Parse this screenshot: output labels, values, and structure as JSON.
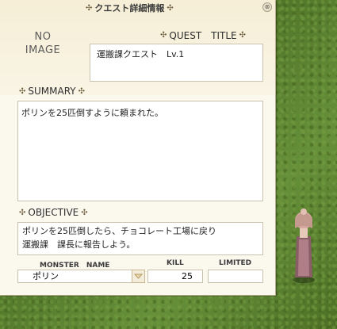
{
  "window": {
    "title": "クエスト詳細情報",
    "close_label": "⊗"
  },
  "image_placeholder": {
    "line1": "NO",
    "line2": "IMAGE"
  },
  "quest_title": {
    "label": "QUEST　TITLE",
    "value": "運搬課クエスト　Lv.1"
  },
  "summary": {
    "label": "SUMMARY",
    "text": "ポリンを25匹倒すように頼まれた。"
  },
  "objective": {
    "label": "OBJECTIVE",
    "lines": [
      "ポリンを25匹倒したら、チョコレート工場に戻り",
      "運搬課　課長に報告しよう。"
    ]
  },
  "table": {
    "headers": {
      "monster": "MONSTER　NAME",
      "kill": "KILL",
      "limited": "LIMITED"
    },
    "row": {
      "monster": "ポリン",
      "kill": "25",
      "limited": ""
    }
  },
  "icons": {
    "section_marker": "clover-icon",
    "dropdown": "triangle-down-icon",
    "close": "close-icon"
  }
}
